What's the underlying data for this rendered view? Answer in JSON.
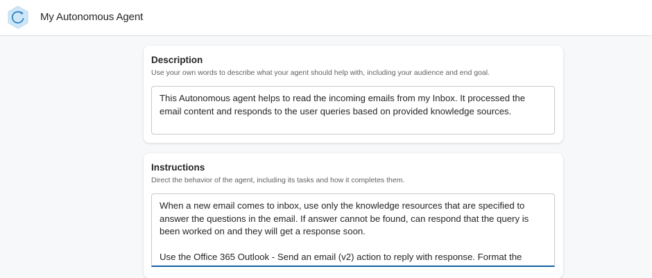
{
  "header": {
    "agent_name": "My Autonomous Agent",
    "icon": "agent-hexagon-icon"
  },
  "description": {
    "title": "Description",
    "helper": "Use your own words to describe what your agent should help with, including your audience and end goal.",
    "value": "This Autonomous agent helps to read the incoming emails from my Inbox. It processed the email content and responds to the user queries based on provided knowledge sources."
  },
  "instructions": {
    "title": "Instructions",
    "helper": "Direct the behavior of the agent, including its tasks and how it completes them.",
    "value": "When a new email comes to inbox, use only the knowledge resources that are specified to answer the questions in the email. If answer cannot be found, can respond that the query is been worked on and they will get a response soon.\n\nUse the Office 365 Outlook - Send an email (v2) action to reply with response. Format the HTML"
  },
  "colors": {
    "accent": "#115ea3",
    "icon_fill": "#cfe6f7",
    "icon_stroke": "#2c83c4"
  }
}
